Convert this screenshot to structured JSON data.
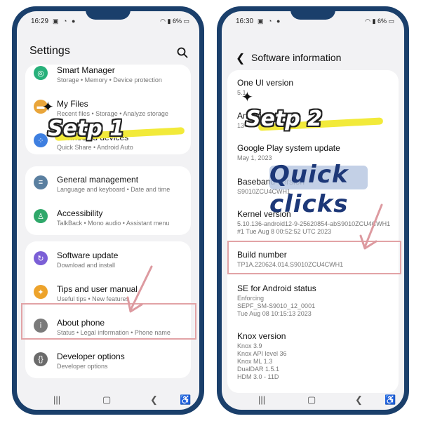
{
  "left_phone": {
    "status": {
      "time": "16:29",
      "battery": "6%",
      "icons": "▣ ◔ ●"
    },
    "header": {
      "title": "Settings"
    },
    "items": [
      {
        "title": "Smart Manager",
        "sub": "Storage  •  Memory  •  Device protection"
      },
      {
        "title": "My Files",
        "sub": "Recent files  •  Storage  •  Analyze storage"
      },
      {
        "title": "Connected devices",
        "sub": "Quick Share  •  Android Auto"
      },
      {
        "title": "General management",
        "sub": "Language and keyboard  •  Date and time"
      },
      {
        "title": "Accessibility",
        "sub": "TalkBack  •  Mono audio  •  Assistant menu"
      },
      {
        "title": "Software update",
        "sub": "Download and install"
      },
      {
        "title": "Tips and user manual",
        "sub": "Useful tips  •  New features"
      },
      {
        "title": "About phone",
        "sub": "Status  •  Legal information  •  Phone name"
      },
      {
        "title": "Developer options",
        "sub": "Developer options"
      }
    ],
    "step_label": "Setp 1"
  },
  "right_phone": {
    "status": {
      "time": "16:30",
      "battery": "6%",
      "icons": "▣ ◔ ●"
    },
    "header": {
      "title": "Software information"
    },
    "items": [
      {
        "title": "One UI version",
        "sub": [
          "5.1"
        ]
      },
      {
        "title": "Android version",
        "sub": [
          "13"
        ]
      },
      {
        "title": "Google Play system update",
        "sub": [
          "May 1, 2023"
        ]
      },
      {
        "title": "Baseband version",
        "sub": [
          "S9010ZCU4CWH1"
        ]
      },
      {
        "title": "Kernel version",
        "sub": [
          "5.10.136-android12-9-25620854-abS9010ZCU4CWH1",
          "#1 Tue Aug 8 00:52:52 UTC 2023"
        ]
      },
      {
        "title": "Build number",
        "sub": [
          "TP1A.220624.014.S9010ZCU4CWH1"
        ]
      },
      {
        "title": "SE for Android status",
        "sub": [
          "Enforcing",
          "SEPF_SM-S9010_12_0001",
          "Tue Aug 08 10:15:13 2023"
        ]
      },
      {
        "title": "Knox version",
        "sub": [
          "Knox 3.9",
          "Knox API level 36",
          "Knox ML 1.3",
          "DualDAR 1.5.1",
          "HDM 3.0 - 11D"
        ]
      }
    ],
    "step_label": "Setp 2",
    "annotation": "Quick clicks"
  },
  "colors": {
    "highlight": "#e2a3a6",
    "frame": "#1a3f6b",
    "yellow": "#f2ea3a",
    "quick_text": "#1d3878"
  }
}
